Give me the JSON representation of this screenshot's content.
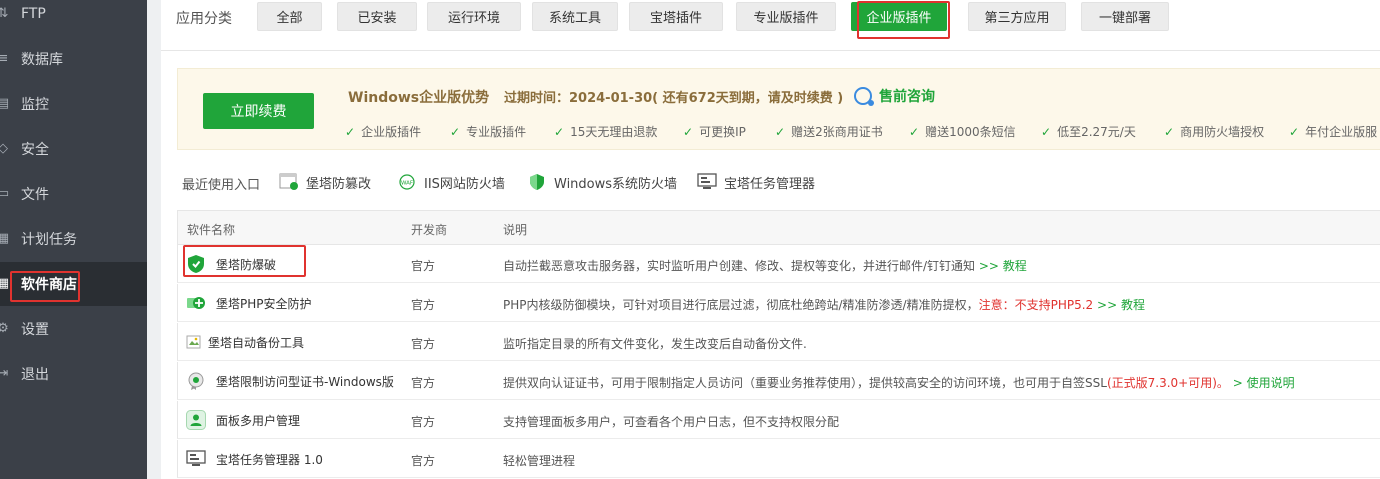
{
  "sidebar": {
    "items": [
      {
        "label": "FTP",
        "icon": "ftp-icon"
      },
      {
        "label": "数据库",
        "icon": "database-icon"
      },
      {
        "label": "监控",
        "icon": "monitor-icon"
      },
      {
        "label": "安全",
        "icon": "security-icon"
      },
      {
        "label": "文件",
        "icon": "file-icon"
      },
      {
        "label": "计划任务",
        "icon": "schedule-icon"
      },
      {
        "label": "软件商店",
        "icon": "store-icon",
        "active": true
      },
      {
        "label": "设置",
        "icon": "gear-icon"
      },
      {
        "label": "退出",
        "icon": "logout-icon"
      }
    ]
  },
  "categories": {
    "label": "应用分类",
    "items": [
      "全部",
      "已安装",
      "运行环境",
      "系统工具",
      "宝塔插件",
      "专业版插件",
      "企业版插件",
      "第三方应用",
      "一键部署"
    ],
    "active": "企业版插件"
  },
  "banner": {
    "renew_label": "立即续费",
    "title": "Windows企业版优势",
    "expire": "过期时间：2024-01-30( 还有672天到期，请及时续费 )",
    "consult": "售前咨询",
    "perks": [
      "企业版插件",
      "专业版插件",
      "15天无理由退款",
      "可更换IP",
      "赠送2张商用证书",
      "赠送1000条短信",
      "低至2.27元/天",
      "商用防火墙授权",
      "年付企业版服"
    ]
  },
  "recent": {
    "label": "最近使用入口",
    "items": [
      {
        "label": "堡塔防篡改",
        "icon": "tamper-proof-icon"
      },
      {
        "label": "IIS网站防火墙",
        "icon": "waf-icon"
      },
      {
        "label": "Windows系统防火墙",
        "icon": "shield-icon"
      },
      {
        "label": "宝塔任务管理器",
        "icon": "task-manager-icon"
      }
    ]
  },
  "table": {
    "headers": {
      "name": "软件名称",
      "dev": "开发商",
      "desc": "说明"
    },
    "rows": [
      {
        "name": "堡塔防爆破",
        "dev": "官方",
        "desc": "自动拦截恶意攻击服务器，实时监听用户创建、修改、提权等变化，并进行邮件/钉钉通知",
        "link": ">> 教程",
        "icon": "anti-brute-force-icon"
      },
      {
        "name": "堡塔PHP安全防护",
        "dev": "官方",
        "desc": "PHP内核级防御模块，可针对项目进行底层过滤，彻底杜绝跨站/精准防渗透/精准防提权，",
        "warn": "注意：不支持PHP5.2",
        "link": ">> 教程",
        "icon": "php-security-icon"
      },
      {
        "name": "堡塔自动备份工具",
        "dev": "官方",
        "desc": "监听指定目录的所有文件变化，发生改变后自动备份文件.",
        "icon": "broken-image-icon"
      },
      {
        "name": "堡塔限制访问型证书-Windows版",
        "dev": "官方",
        "desc": "提供双向认证证书，可用于限制指定人员访问（重要业务推荐使用），提供较高安全的访问环境，也可用于自签SSL",
        "warn": "(正式版7.3.0+可用)。",
        "link": "> 使用说明",
        "icon": "certificate-icon"
      },
      {
        "name": "面板多用户管理",
        "dev": "官方",
        "desc": "支持管理面板多用户，可查看各个用户日志，但不支持权限分配",
        "icon": "users-icon"
      },
      {
        "name": "宝塔任务管理器 1.0",
        "dev": "官方",
        "desc": "轻松管理进程",
        "icon": "task-manager-icon"
      }
    ]
  },
  "colors": {
    "accent": "#20a53a",
    "highlight": "#e0332f",
    "sidebar": "#3b4048"
  }
}
